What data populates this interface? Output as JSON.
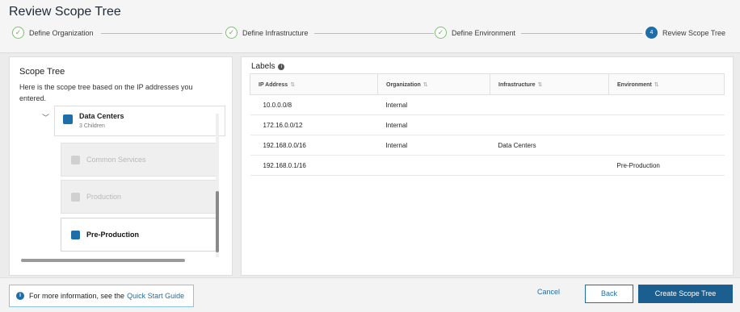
{
  "header": {
    "title": "Review Scope Tree"
  },
  "steps": [
    {
      "label": "Define Organization",
      "state": "complete"
    },
    {
      "label": "Define Infrastructure",
      "state": "complete"
    },
    {
      "label": "Define Environment",
      "state": "complete"
    },
    {
      "label": "Review Scope Tree",
      "state": "current",
      "number": "4"
    }
  ],
  "scope_tree": {
    "title": "Scope Tree",
    "description": "Here is the scope tree based on the IP addresses you entered.",
    "root": {
      "name": "Data Centers",
      "children_label": "3 Children"
    },
    "children": [
      {
        "name": "Common Services",
        "state": "disabled"
      },
      {
        "name": "Production",
        "state": "disabled"
      },
      {
        "name": "Pre-Production",
        "state": "selected"
      }
    ]
  },
  "labels": {
    "title": "Labels",
    "columns": [
      "IP Address",
      "Organization",
      "Infrastructure",
      "Environment"
    ],
    "rows": [
      [
        "10.0.0.0/8",
        "Internal",
        "",
        ""
      ],
      [
        "172.16.0.0/12",
        "Internal",
        "",
        ""
      ],
      [
        "192.168.0.0/16",
        "Internal",
        "Data Centers",
        ""
      ],
      [
        "192.168.0.1/16",
        "",
        "",
        "Pre-Production"
      ]
    ]
  },
  "footer": {
    "info_text": "For more information, see the",
    "info_link": "Quick Start Guide",
    "cancel_label": "Cancel",
    "back_label": "Back",
    "create_label": "Create Scope Tree"
  },
  "colors": {
    "accent": "#1e6ea8",
    "step_complete": "#6fb25e",
    "primary_button": "#1a5f8f"
  }
}
